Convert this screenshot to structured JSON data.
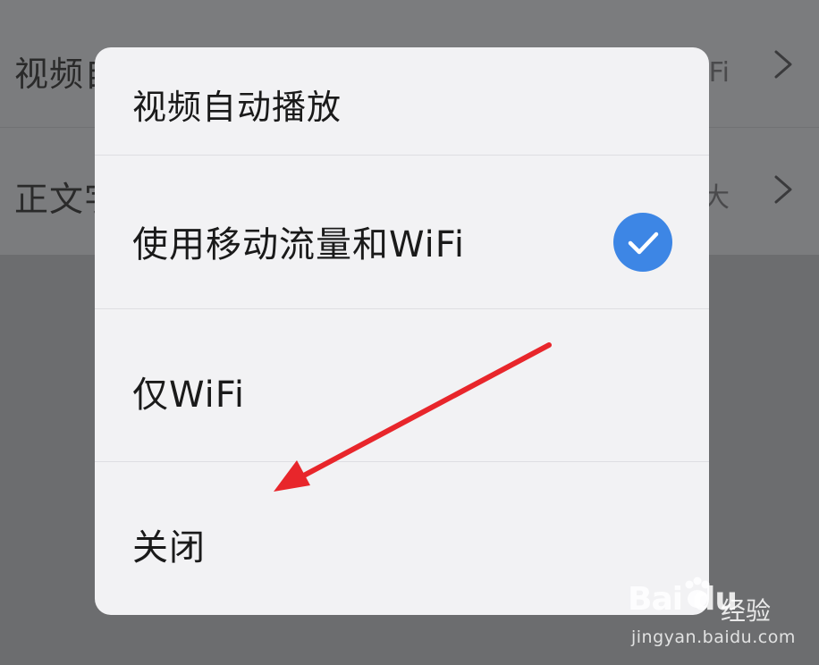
{
  "background": {
    "rows": [
      {
        "label": "视频自动播放",
        "value": "仅WiFi"
      },
      {
        "label": "正文字号",
        "value": "大"
      }
    ]
  },
  "dialog": {
    "title": "视频自动播放",
    "options": [
      {
        "label": "使用移动流量和WiFi",
        "selected": true
      },
      {
        "label": "仅WiFi",
        "selected": false
      },
      {
        "label": "关闭",
        "selected": false
      }
    ]
  },
  "colors": {
    "accent": "#3d86e5",
    "annotation": "#e8262b",
    "dialog_bg": "#f2f2f4"
  },
  "icons": {
    "selected": "checkmark-circle-icon",
    "row_arrow": "chevron-right-icon",
    "annotation": "red-arrow-icon"
  },
  "watermark": {
    "brand": "Bai du",
    "product": "经验",
    "url": "jingyan.baidu.com"
  }
}
